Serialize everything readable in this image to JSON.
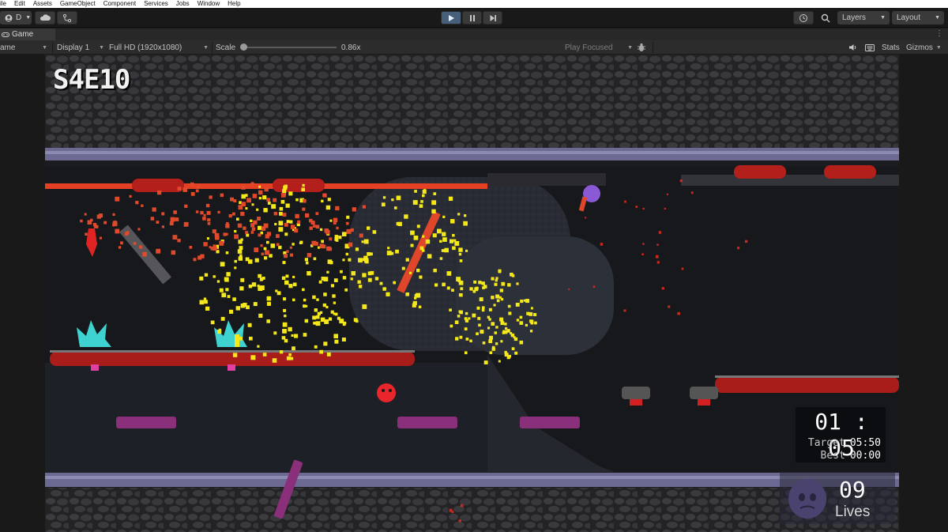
{
  "menu": {
    "items": [
      "ile",
      "Edit",
      "Assets",
      "GameObject",
      "Component",
      "Services",
      "Jobs",
      "Window",
      "Help"
    ]
  },
  "toolbar": {
    "account_label": "D",
    "layers_label": "Layers",
    "layout_label": "Layout",
    "icons": [
      "account-icon",
      "cloud-icon",
      "version-control-icon",
      "play-icon",
      "pause-icon",
      "step-icon",
      "history-icon",
      "search-icon"
    ]
  },
  "tab": {
    "label": "Game"
  },
  "game_toolbar": {
    "mode_label": "ame",
    "display_label": "Display 1",
    "resolution_label": "Full HD (1920x1080)",
    "scale_label": "Scale",
    "scale_value": "0.86x",
    "play_mode_label": "Play Focused",
    "stats_label": "Stats",
    "gizmos_label": "Gizmos"
  },
  "hud": {
    "level": "S4E10",
    "timer": "01 : 05",
    "target_label": "Target",
    "target_value": "05:50",
    "best_label": "Best",
    "best_value": "00:00",
    "lives_count": "09",
    "lives_label": "Lives"
  },
  "colors": {
    "editor_bg": "#191919",
    "toolbar_bg": "#282828",
    "play_active": "#46607c",
    "lava": "#b3201c",
    "spark_yellow": "#f5e81a",
    "rail": "#6c6a92",
    "platform_purple": "#8a2f7a",
    "enemy_teal": "#3ed3d0",
    "player_red": "#e8262b",
    "ghost_purple": "#8a5ad6"
  }
}
